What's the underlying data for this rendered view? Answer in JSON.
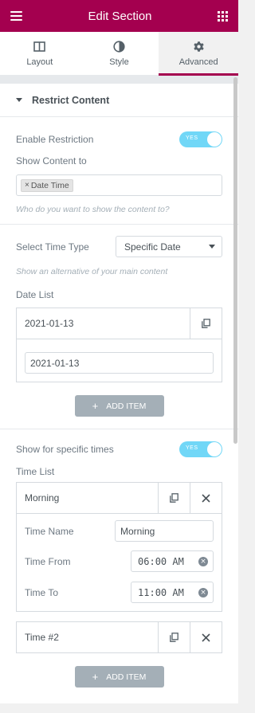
{
  "header": {
    "title": "Edit Section",
    "menu_icon": "hamburger-icon",
    "apps_icon": "grid-icon"
  },
  "tabs": [
    {
      "label": "Layout",
      "icon": "layout-columns-icon",
      "active": false
    },
    {
      "label": "Style",
      "icon": "half-circle-icon",
      "active": false
    },
    {
      "label": "Advanced",
      "icon": "gear-icon",
      "active": true
    }
  ],
  "accent_color": "#a4004f",
  "section": {
    "title": "Restrict Content"
  },
  "restriction": {
    "enable_label": "Enable Restriction",
    "enable_toggle": "YES",
    "show_content_label": "Show Content to",
    "show_content_tag": "Date Time",
    "show_content_hint": "Who do you want to show the content to?"
  },
  "time_type": {
    "label": "Select Time Type",
    "value": "Specific Date",
    "hint": "Show an alternative of your main content"
  },
  "date_list": {
    "label": "Date List",
    "items": [
      {
        "title": "2021-01-13",
        "value": "2021-01-13"
      }
    ],
    "add_label": "ADD ITEM"
  },
  "specific_times": {
    "label": "Show for specific times",
    "toggle": "YES"
  },
  "time_list": {
    "label": "Time List",
    "items": [
      {
        "title": "Morning",
        "name_label": "Time Name",
        "name_value": "Morning",
        "from_label": "Time From",
        "from_hour": "06",
        "from_min": "00",
        "from_ampm": "AM",
        "to_label": "Time To",
        "to_hour": "11",
        "to_min": "00",
        "to_ampm": "AM"
      },
      {
        "title": "Time #2"
      }
    ],
    "add_label": "ADD ITEM"
  }
}
